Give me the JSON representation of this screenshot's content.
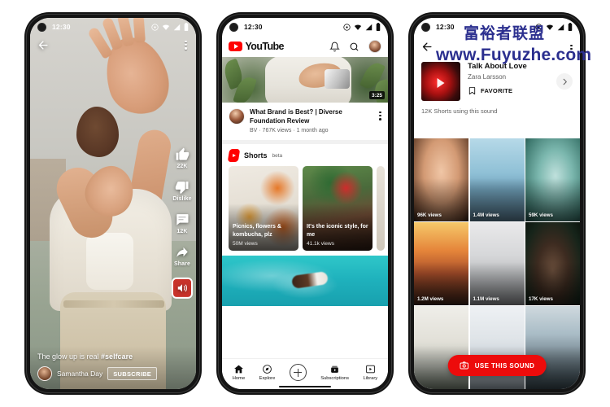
{
  "watermark": {
    "cn_text": "富裕者联盟",
    "url_text": "www.Fuyuzhe.com",
    "color": "#2b2f8f"
  },
  "colors": {
    "brand_red": "#FF0000",
    "button_red": "#ED0B0B",
    "text_primary": "#0f0f0f",
    "text_secondary": "#606060",
    "phone_frame": "#141414"
  },
  "phones": [
    {
      "id": "shorts-player",
      "status_bar": {
        "time": "12:30",
        "icons": [
          "vpn-key-icon",
          "wifi-icon",
          "signal-icon",
          "battery-icon"
        ]
      },
      "back_icon": "back-arrow-icon",
      "overflow_icon": "kebab-menu-icon",
      "rail": [
        {
          "icon": "thumbs-up-icon",
          "label": "22K",
          "name": "like-button"
        },
        {
          "icon": "thumbs-down-icon",
          "label": "Dislike",
          "name": "dislike-button"
        },
        {
          "icon": "comment-icon",
          "label": "12K",
          "name": "comment-button"
        },
        {
          "icon": "share-icon",
          "label": "Share",
          "name": "share-button"
        }
      ],
      "sound_button_icon": "sound-disc-icon",
      "caption_plain": "The glow up is real ",
      "caption_hashtag": "#selfcare",
      "channel_name": "Samantha Day",
      "subscribe_label": "SUBSCRIBE"
    },
    {
      "id": "youtube-home",
      "status_bar": {
        "time": "12:30",
        "icons": [
          "vpn-key-icon",
          "wifi-icon",
          "signal-icon",
          "battery-icon"
        ]
      },
      "logo_text": "YouTube",
      "header_icons": [
        "bell-icon",
        "search-icon",
        "account-avatar"
      ],
      "video": {
        "duration": "3:25",
        "title": "What Brand is Best? | Diverse Foundation Review",
        "meta": "BV · 767K views · 1 month ago",
        "overflow_icon": "kebab-menu-icon"
      },
      "shorts_section": {
        "label": "Shorts",
        "badge": "beta",
        "cards": [
          {
            "title": "Picnics, flowers & kombucha, plz",
            "views": "50M views"
          },
          {
            "title": "It's the iconic style, for me",
            "views": "41.1k views"
          }
        ]
      },
      "bottom_nav": [
        {
          "label": "Home",
          "icon": "home-icon"
        },
        {
          "label": "Explore",
          "icon": "compass-icon"
        },
        {
          "label": "",
          "icon": "plus-circle-icon"
        },
        {
          "label": "Subscriptions",
          "icon": "subscriptions-icon"
        },
        {
          "label": "Library",
          "icon": "library-icon"
        }
      ]
    },
    {
      "id": "sound-detail",
      "status_bar": {
        "time": "12:30",
        "icons": [
          "vpn-key-icon",
          "wifi-icon",
          "signal-icon",
          "battery-icon"
        ]
      },
      "back_icon": "back-arrow-icon",
      "overflow_icon": "kebab-menu-icon",
      "sound": {
        "title": "Talk About Love",
        "artist": "Zara Larsson",
        "favorite_label": "FAVORITE",
        "favorite_icon": "bookmark-icon",
        "chevron_icon": "chevron-right-icon",
        "cover_icon": "play-icon"
      },
      "shorts_count": "12K Shorts using this sound",
      "grid": [
        {
          "views": "96K views"
        },
        {
          "views": "1.4M views"
        },
        {
          "views": "59K views"
        },
        {
          "views": "1.2M views"
        },
        {
          "views": "1.1M views"
        },
        {
          "views": "17K views"
        },
        {
          "views": ""
        },
        {
          "views": ""
        },
        {
          "views": ""
        }
      ],
      "cta": {
        "label": "USE THIS SOUND",
        "icon": "camera-icon"
      }
    }
  ]
}
